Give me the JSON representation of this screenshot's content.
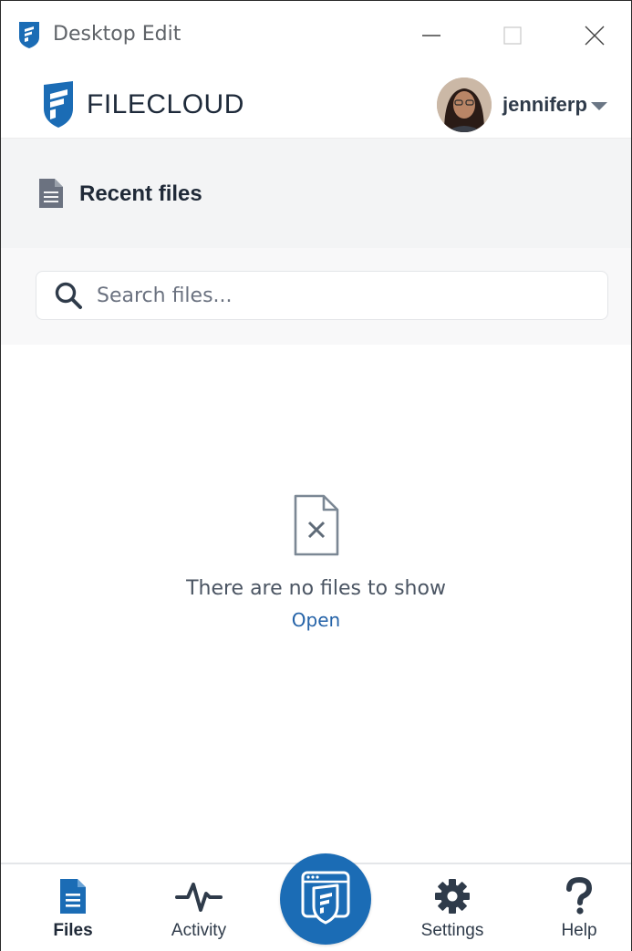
{
  "window": {
    "title": "Desktop Edit"
  },
  "header": {
    "logo_text": "FILECLOUD",
    "username": "jenniferp"
  },
  "section": {
    "heading": "Recent files"
  },
  "search": {
    "placeholder": "Search files..."
  },
  "empty_state": {
    "message": "There are no files to show",
    "link": "Open"
  },
  "nav": {
    "files": "Files",
    "activity": "Activity",
    "settings": "Settings",
    "help": "Help",
    "active": "files"
  },
  "colors": {
    "brand_blue": "#1b6cb5",
    "link_blue": "#2563a8",
    "text_dark": "#1f2937"
  },
  "icons": {
    "app": "filecloud-shield-icon",
    "heading": "document-icon",
    "search": "search-icon",
    "empty": "file-x-icon",
    "files": "file-icon",
    "activity": "pulse-icon",
    "center": "filecloud-app-icon",
    "settings": "gear-icon",
    "help": "question-mark-icon"
  }
}
